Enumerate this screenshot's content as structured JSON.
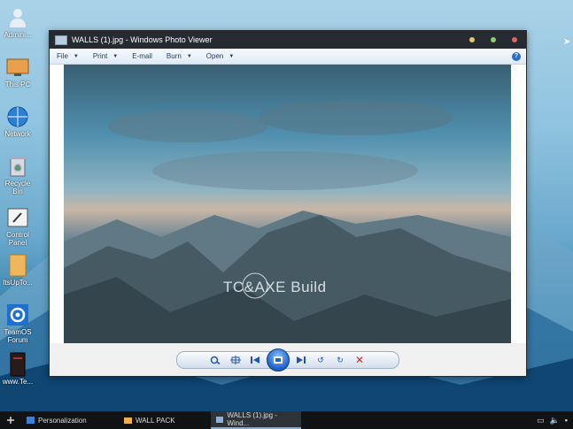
{
  "desktop": {
    "icons": [
      {
        "label": "Admini...",
        "icon": "user-icon"
      },
      {
        "label": "This PC",
        "icon": "computer-icon"
      },
      {
        "label": "Network",
        "icon": "network-icon"
      },
      {
        "label": "Recycle Bin",
        "icon": "recycle-bin-icon"
      },
      {
        "label": "Control Panel",
        "icon": "control-panel-icon"
      },
      {
        "label": "ItsUpTo...",
        "icon": "folder-icon"
      },
      {
        "label": "TeamOS Forum",
        "icon": "gear-icon"
      },
      {
        "label": "www.Te...",
        "icon": "book-icon"
      }
    ]
  },
  "window": {
    "title": "WALLS (1).jpg - Windows Photo Viewer",
    "menu": {
      "file": "File",
      "print": "Print",
      "email": "E-mail",
      "burn": "Burn",
      "open": "Open"
    },
    "watermark": "TC&AXE Build",
    "controls": {
      "close_color": "#d42a2a",
      "accent": "#1c5fc7"
    }
  },
  "taskbar": {
    "items": [
      {
        "label": "Personalization",
        "icon": "personalization-icon"
      },
      {
        "label": "WALL PACK",
        "icon": "folder-icon"
      },
      {
        "label": "WALLS (1).jpg - Wind...",
        "icon": "photo-viewer-icon"
      }
    ]
  }
}
